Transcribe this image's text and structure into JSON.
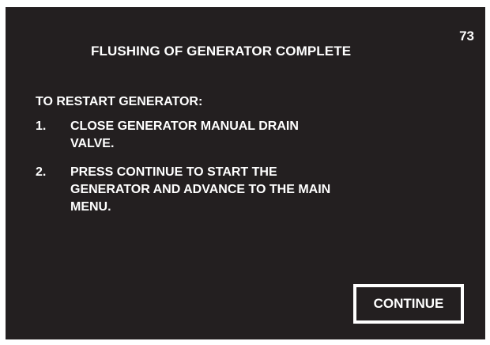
{
  "screen": {
    "number": "73",
    "title": "FLUSHING OF GENERATOR COMPLETE",
    "instructions_heading": "TO RESTART GENERATOR:",
    "steps": [
      {
        "num": "1.",
        "text": "CLOSE GENERATOR MANUAL DRAIN VALVE."
      },
      {
        "num": "2.",
        "text": "PRESS CONTINUE TO START THE GENERATOR AND ADVANCE TO THE MAIN MENU."
      }
    ],
    "continue_label": "CONTINUE"
  }
}
